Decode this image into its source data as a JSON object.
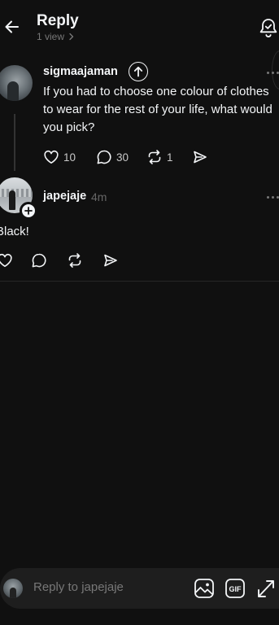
{
  "header": {
    "title": "Reply",
    "views": "1 view"
  },
  "post": {
    "username": "sigmaajaman",
    "text": "If you had to choose one colour of clothes to wear for the rest of your life, what would you pick?",
    "likes": "10",
    "comments": "30",
    "reposts": "1"
  },
  "reply": {
    "username": "japejaje",
    "time": "4m",
    "text": "Black!"
  },
  "composer": {
    "placeholder": "Reply to japejaje"
  },
  "colors": {
    "background": "#101010",
    "text": "#f3f5f7",
    "muted": "#777777",
    "composer_bg": "#1e1e1e"
  }
}
